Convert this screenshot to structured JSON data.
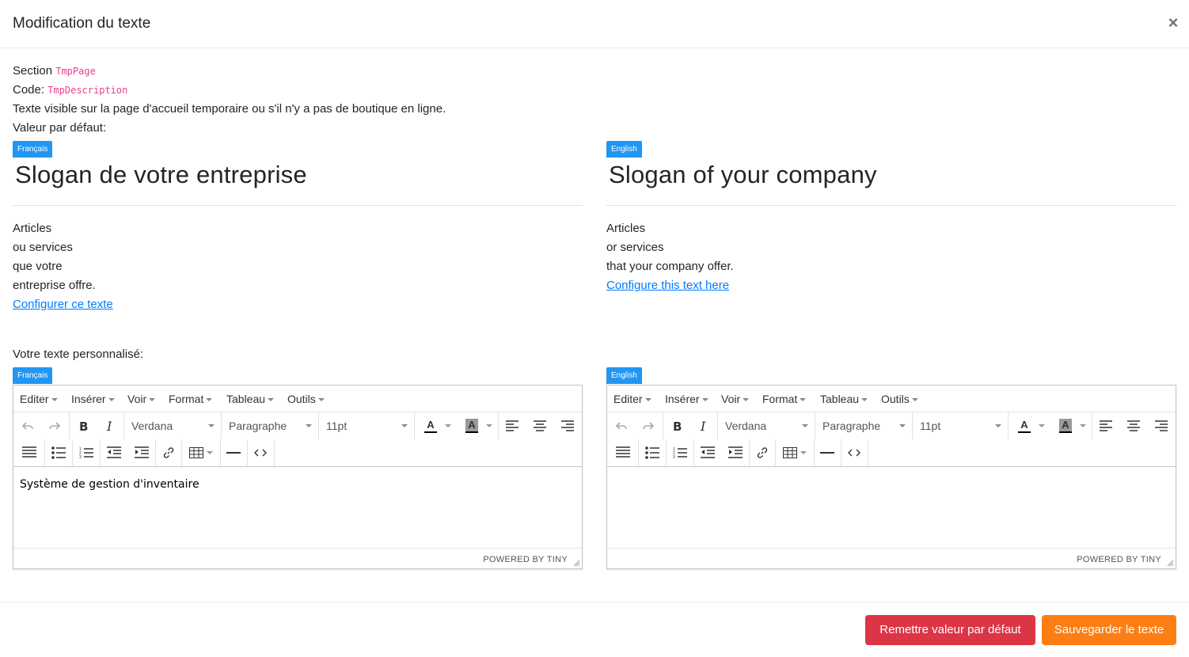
{
  "modal": {
    "title": "Modification du texte",
    "close_symbol": "×"
  },
  "info": {
    "section_label": "Section",
    "section_value": "TmpPage",
    "code_label": "Code:",
    "code_value": "TmpDescription",
    "description": "Texte visible sur la page d'accueil temporaire ou s'il n'y a pas de boutique en ligne.",
    "default_label": "Valeur par défaut:"
  },
  "defaults": [
    {
      "lang": "Français",
      "slogan": "Slogan de votre entreprise",
      "lines": [
        "Articles",
        "ou services",
        "que votre",
        "entreprise offre."
      ],
      "link": "Configurer ce texte"
    },
    {
      "lang": "English",
      "slogan": "Slogan of your company",
      "lines": [
        "Articles",
        "or services",
        "that your company offer."
      ],
      "link": "Configure this text here"
    }
  ],
  "custom_label": "Votre texte personnalisé:",
  "editors": [
    {
      "lang": "Français",
      "content": "Système de gestion d'inventaire"
    },
    {
      "lang": "English",
      "content": ""
    }
  ],
  "editor_ui": {
    "menus": [
      "Editer",
      "Insérer",
      "Voir",
      "Format",
      "Tableau",
      "Outils"
    ],
    "font_family": "Verdana",
    "block_format": "Paragraphe",
    "font_size": "11pt",
    "text_color_glyph": "A",
    "bg_color_glyph": "A",
    "powered_by": "POWERED BY TINY",
    "icons": [
      "undo-icon",
      "redo-icon",
      "bold-icon",
      "italic-icon",
      "text-color-icon",
      "background-color-icon",
      "align-left-icon",
      "align-center-icon",
      "align-right-icon",
      "align-justify-icon",
      "bullet-list-icon",
      "numbered-list-icon",
      "outdent-icon",
      "indent-icon",
      "link-icon",
      "table-icon",
      "horizontal-rule-icon",
      "source-code-icon"
    ]
  },
  "footer": {
    "reset_label": "Remettre valeur par défaut",
    "save_label": "Sauvegarder le texte"
  },
  "colors": {
    "badge": "#2196f3",
    "link": "#007bff",
    "code": "#e83e8c",
    "reset_button": "#dc3545",
    "save_button": "#fd7e14"
  }
}
